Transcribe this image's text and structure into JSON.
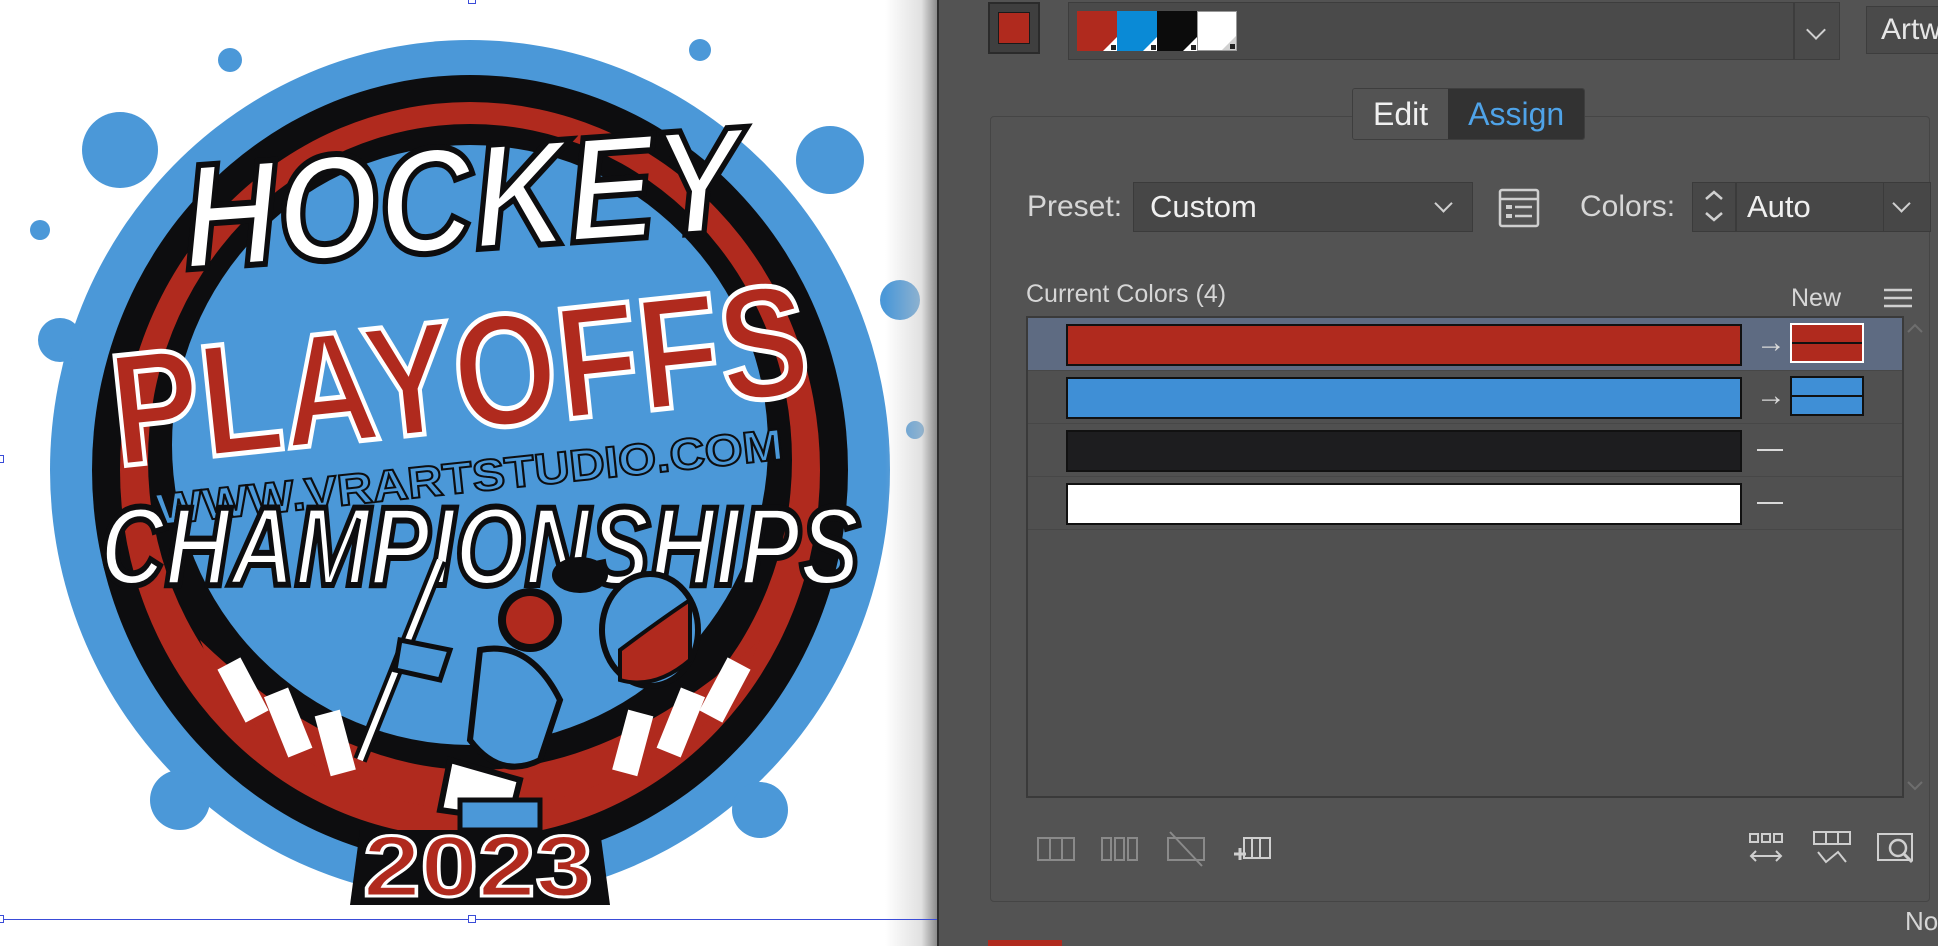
{
  "artwork": {
    "line1": "HOCKEY",
    "line2": "PLAYOFFS",
    "url": "WWW.VRARTSTUDIO.COM",
    "line3": "CHAMPIONSHIPS",
    "year": "2023"
  },
  "panel": {
    "artwork_button": "Artw",
    "tabs": [
      {
        "label": "Edit"
      },
      {
        "label": "Assign"
      }
    ],
    "active_tab": "Assign",
    "preset": {
      "label": "Preset:",
      "value": "Custom"
    },
    "colors": {
      "label": "Colors:",
      "value": "Auto"
    },
    "current_colors_label": "Current Colors (4)",
    "new_label": "New",
    "footer_label": "No",
    "color_rows": [
      {
        "current": "#b02a1e",
        "mapped": true,
        "new": "#b02a1e",
        "selected": true
      },
      {
        "current": "#3f8fd6",
        "mapped": true,
        "new": "#3f8fd6",
        "selected": false
      },
      {
        "current": "#1d1d1f",
        "mapped": false,
        "new": "",
        "selected": false
      },
      {
        "current": "#ffffff",
        "mapped": false,
        "new": "",
        "selected": false
      }
    ],
    "group_swatches": [
      "#b02a1e",
      "#0a8ad6",
      "#0c0c0c",
      "#ffffff"
    ],
    "active_swatch_color": "#b02a1e"
  },
  "colors": {
    "red": "#b02a1e",
    "blue": "#3f8fd6",
    "black": "#0d0d0f",
    "white": "#ffffff",
    "accent": "#4fa3e8"
  },
  "icons": {
    "preset_options": "color-groups-icon",
    "spinner": "up-down-stepper-icon",
    "tools_left": [
      "harmony-rows-icon",
      "split-columns-icon",
      "exclude-color-icon",
      "new-row-icon"
    ],
    "tools_right": [
      "randomize-order-icon",
      "randomize-saturation-icon",
      "find-color-icon"
    ]
  }
}
